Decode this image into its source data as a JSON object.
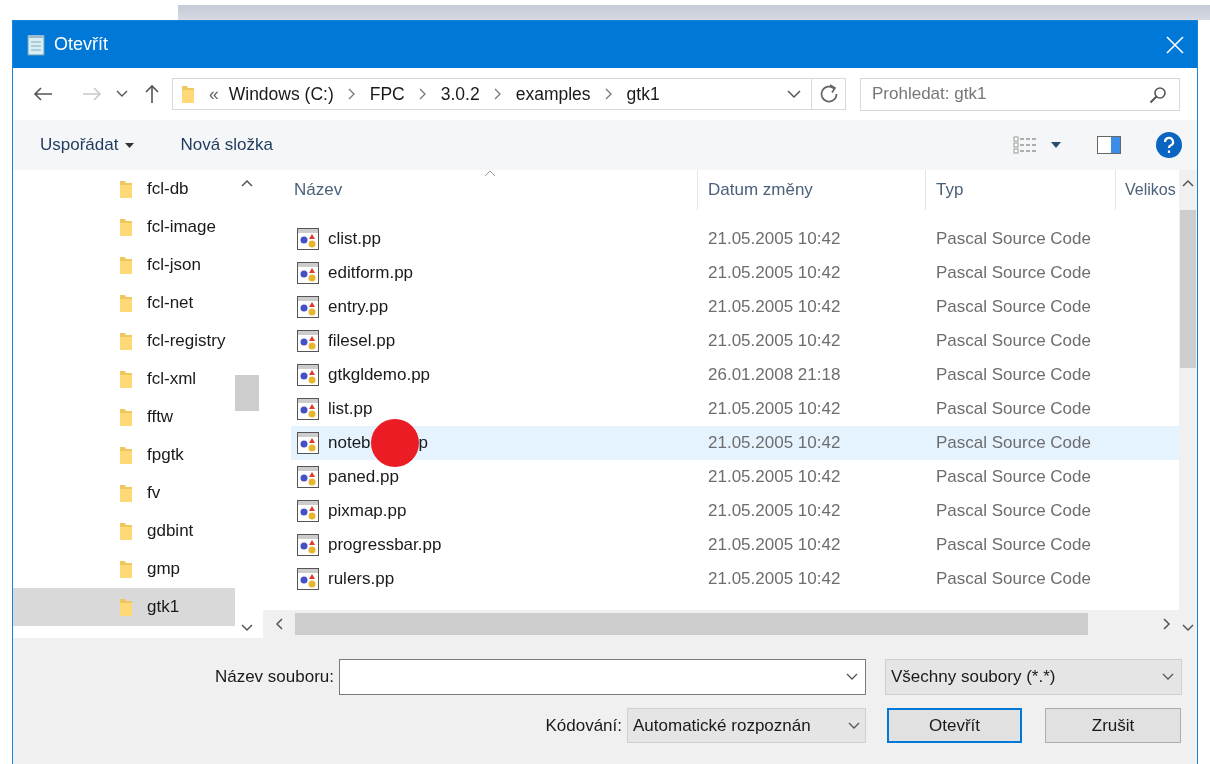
{
  "window": {
    "title": "Otevřít"
  },
  "navigation": {
    "back": {
      "disabled": false
    },
    "forward": {
      "disabled": true
    },
    "overflow": "«",
    "path": [
      "Windows (C:)",
      "FPC",
      "3.0.2",
      "examples",
      "gtk1"
    ],
    "search": {
      "placeholder": "Prohledat: gtk1"
    }
  },
  "toolbar": {
    "organize": "Uspořádat",
    "new_folder": "Nová složka"
  },
  "sidebar": {
    "items": [
      {
        "label": "fcl-db",
        "selected": false
      },
      {
        "label": "fcl-image",
        "selected": false
      },
      {
        "label": "fcl-json",
        "selected": false
      },
      {
        "label": "fcl-net",
        "selected": false
      },
      {
        "label": "fcl-registry",
        "selected": false
      },
      {
        "label": "fcl-xml",
        "selected": false
      },
      {
        "label": "fftw",
        "selected": false
      },
      {
        "label": "fpgtk",
        "selected": false
      },
      {
        "label": "fv",
        "selected": false
      },
      {
        "label": "gdbint",
        "selected": false
      },
      {
        "label": "gmp",
        "selected": false
      },
      {
        "label": "gtk1",
        "selected": true
      }
    ]
  },
  "table": {
    "columns": [
      {
        "label": "Název",
        "sorted": true
      },
      {
        "label": "Datum změny"
      },
      {
        "label": "Typ"
      },
      {
        "label": "Velikos"
      }
    ],
    "rows": [
      {
        "name": "clist.pp",
        "date": "21.05.2005 10:42",
        "type": "Pascal Source Code",
        "hovered": false
      },
      {
        "name": "editform.pp",
        "date": "21.05.2005 10:42",
        "type": "Pascal Source Code",
        "hovered": false
      },
      {
        "name": "entry.pp",
        "date": "21.05.2005 10:42",
        "type": "Pascal Source Code",
        "hovered": false
      },
      {
        "name": "filesel.pp",
        "date": "21.05.2005 10:42",
        "type": "Pascal Source Code",
        "hovered": false
      },
      {
        "name": "gtkgldemo.pp",
        "date": "26.01.2008 21:18",
        "type": "Pascal Source Code",
        "hovered": false
      },
      {
        "name": "list.pp",
        "date": "21.05.2005 10:42",
        "type": "Pascal Source Code",
        "hovered": false
      },
      {
        "name": "noteb",
        "name_after_marker": "p",
        "date": "21.05.2005 10:42",
        "type": "Pascal Source Code",
        "hovered": true
      },
      {
        "name": "paned.pp",
        "date": "21.05.2005 10:42",
        "type": "Pascal Source Code",
        "hovered": false
      },
      {
        "name": "pixmap.pp",
        "date": "21.05.2005 10:42",
        "type": "Pascal Source Code",
        "hovered": false
      },
      {
        "name": "progressbar.pp",
        "date": "21.05.2005 10:42",
        "type": "Pascal Source Code",
        "hovered": false
      },
      {
        "name": "rulers.pp",
        "date": "21.05.2005 10:42",
        "type": "Pascal Source Code",
        "hovered": false
      }
    ]
  },
  "footer": {
    "filename_label": "Název souboru:",
    "filter": "Všechny soubory  (*.*)",
    "encoding_label": "Kódování:",
    "encoding": "Automatické rozpoznán",
    "buttons": [
      {
        "label": "Otevřít",
        "default": true
      },
      {
        "label": "Zrušit",
        "default": false
      }
    ]
  }
}
